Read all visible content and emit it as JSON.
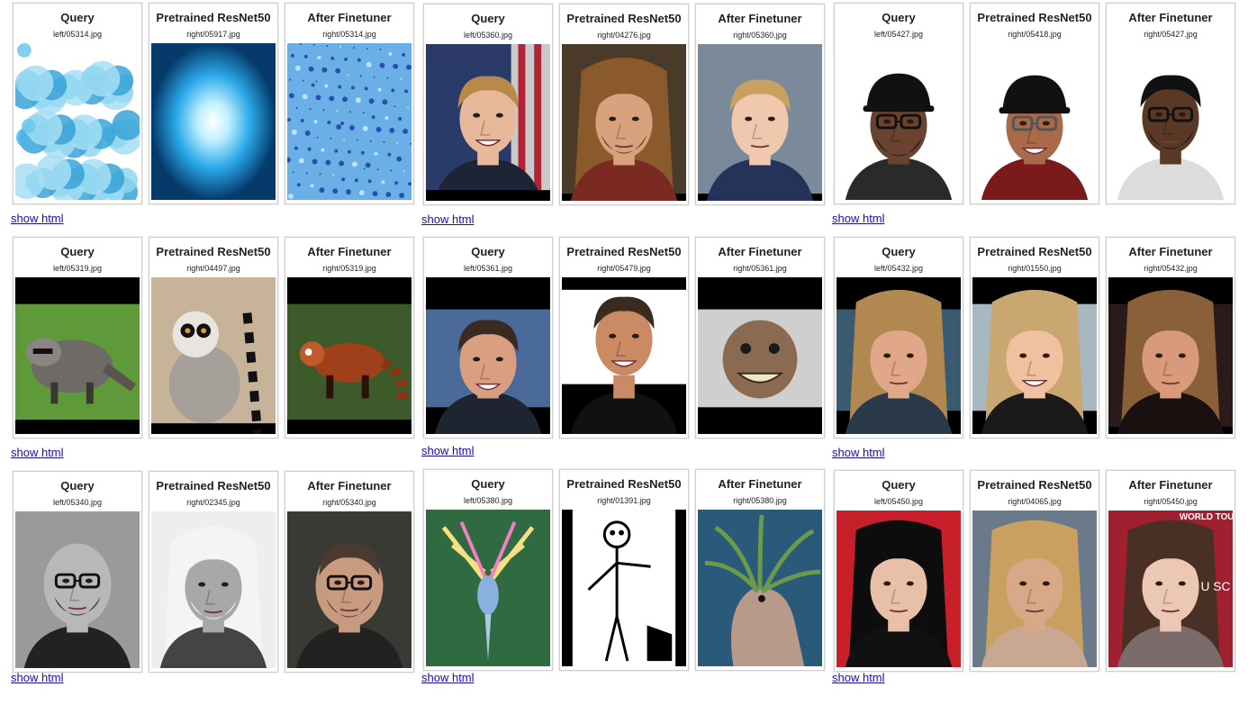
{
  "rows": [
    {
      "groups": [
        {
          "link": "show html",
          "cards": [
            {
              "title": "Query",
              "file": "left/05314.jpg",
              "thumb": "blue-crystals-image"
            },
            {
              "title": "Pretrained ResNet50",
              "file": "right/05917.jpg",
              "thumb": "blue-light-burst-image"
            },
            {
              "title": "After Finetuner",
              "file": "right/05314.jpg",
              "thumb": "blue-speckle-image"
            }
          ]
        },
        {
          "link": "show html",
          "cards": [
            {
              "title": "Query",
              "file": "left/05360.jpg",
              "thumb": "woman-uniform-flag-image"
            },
            {
              "title": "Pretrained ResNet50",
              "file": "right/04276.jpg",
              "thumb": "man-curly-hair-image"
            },
            {
              "title": "After Finetuner",
              "file": "right/05360.jpg",
              "thumb": "woman-short-blond-hair-image"
            }
          ]
        },
        {
          "link": "show html",
          "cards": [
            {
              "title": "Query",
              "file": "left/05427.jpg",
              "thumb": "man-black-cap-glasses-image"
            },
            {
              "title": "Pretrained ResNet50",
              "file": "right/05418.jpg",
              "thumb": "man-cap-smiling-image"
            },
            {
              "title": "After Finetuner",
              "file": "right/05427.jpg",
              "thumb": "man-glasses-beard-image"
            }
          ]
        }
      ]
    },
    {
      "groups": [
        {
          "link": "show html",
          "cards": [
            {
              "title": "Query",
              "file": "left/05319.jpg",
              "thumb": "raccoon-grass-image"
            },
            {
              "title": "Pretrained ResNet50",
              "file": "right/04497.jpg",
              "thumb": "lemur-image"
            },
            {
              "title": "After Finetuner",
              "file": "right/05319.jpg",
              "thumb": "red-panda-image"
            }
          ]
        },
        {
          "link": "show html",
          "cards": [
            {
              "title": "Query",
              "file": "left/05361.jpg",
              "thumb": "man-smiling-suit-image"
            },
            {
              "title": "Pretrained ResNet50",
              "file": "right/05479.jpg",
              "thumb": "man-grinning-image"
            },
            {
              "title": "After Finetuner",
              "file": "right/05361.jpg",
              "thumb": "creature-face-image"
            }
          ]
        },
        {
          "link": "show html",
          "cards": [
            {
              "title": "Query",
              "file": "left/05432.jpg",
              "thumb": "woman-blond-image"
            },
            {
              "title": "Pretrained ResNet50",
              "file": "right/01550.jpg",
              "thumb": "woman-laughing-image"
            },
            {
              "title": "After Finetuner",
              "file": "right/05432.jpg",
              "thumb": "woman-smiling-image"
            }
          ]
        }
      ]
    },
    {
      "groups": [
        {
          "link": "show html",
          "cards": [
            {
              "title": "Query",
              "file": "left/05340.jpg",
              "thumb": "bald-man-glasses-bw-image"
            },
            {
              "title": "Pretrained ResNet50",
              "file": "right/02345.jpg",
              "thumb": "old-man-white-beard-image"
            },
            {
              "title": "After Finetuner",
              "file": "right/05340.jpg",
              "thumb": "man-glasses-goatee-image"
            }
          ]
        },
        {
          "link": "show html",
          "cards": [
            {
              "title": "Query",
              "file": "left/05380.jpg",
              "thumb": "deer-creature-image"
            },
            {
              "title": "Pretrained ResNet50",
              "file": "right/01391.jpg",
              "thumb": "skeleton-drawing-image"
            },
            {
              "title": "After Finetuner",
              "file": "right/05380.jpg",
              "thumb": "forest-spirit-image"
            }
          ]
        },
        {
          "link": "show html",
          "cards": [
            {
              "title": "Query",
              "file": "left/05450.jpg",
              "thumb": "man-long-black-hair-image"
            },
            {
              "title": "Pretrained ResNet50",
              "file": "right/04065.jpg",
              "thumb": "man-long-blond-hair-image"
            },
            {
              "title": "After Finetuner",
              "file": "right/05450.jpg",
              "thumb": "woman-long-hair-image"
            }
          ]
        }
      ]
    }
  ],
  "thumb_texts": {
    "banner": "WORLD TOU",
    "side": "U SC"
  },
  "colors": {
    "link": "#1a0dab",
    "card_border": "#cfcfcf",
    "title": "#222222"
  }
}
